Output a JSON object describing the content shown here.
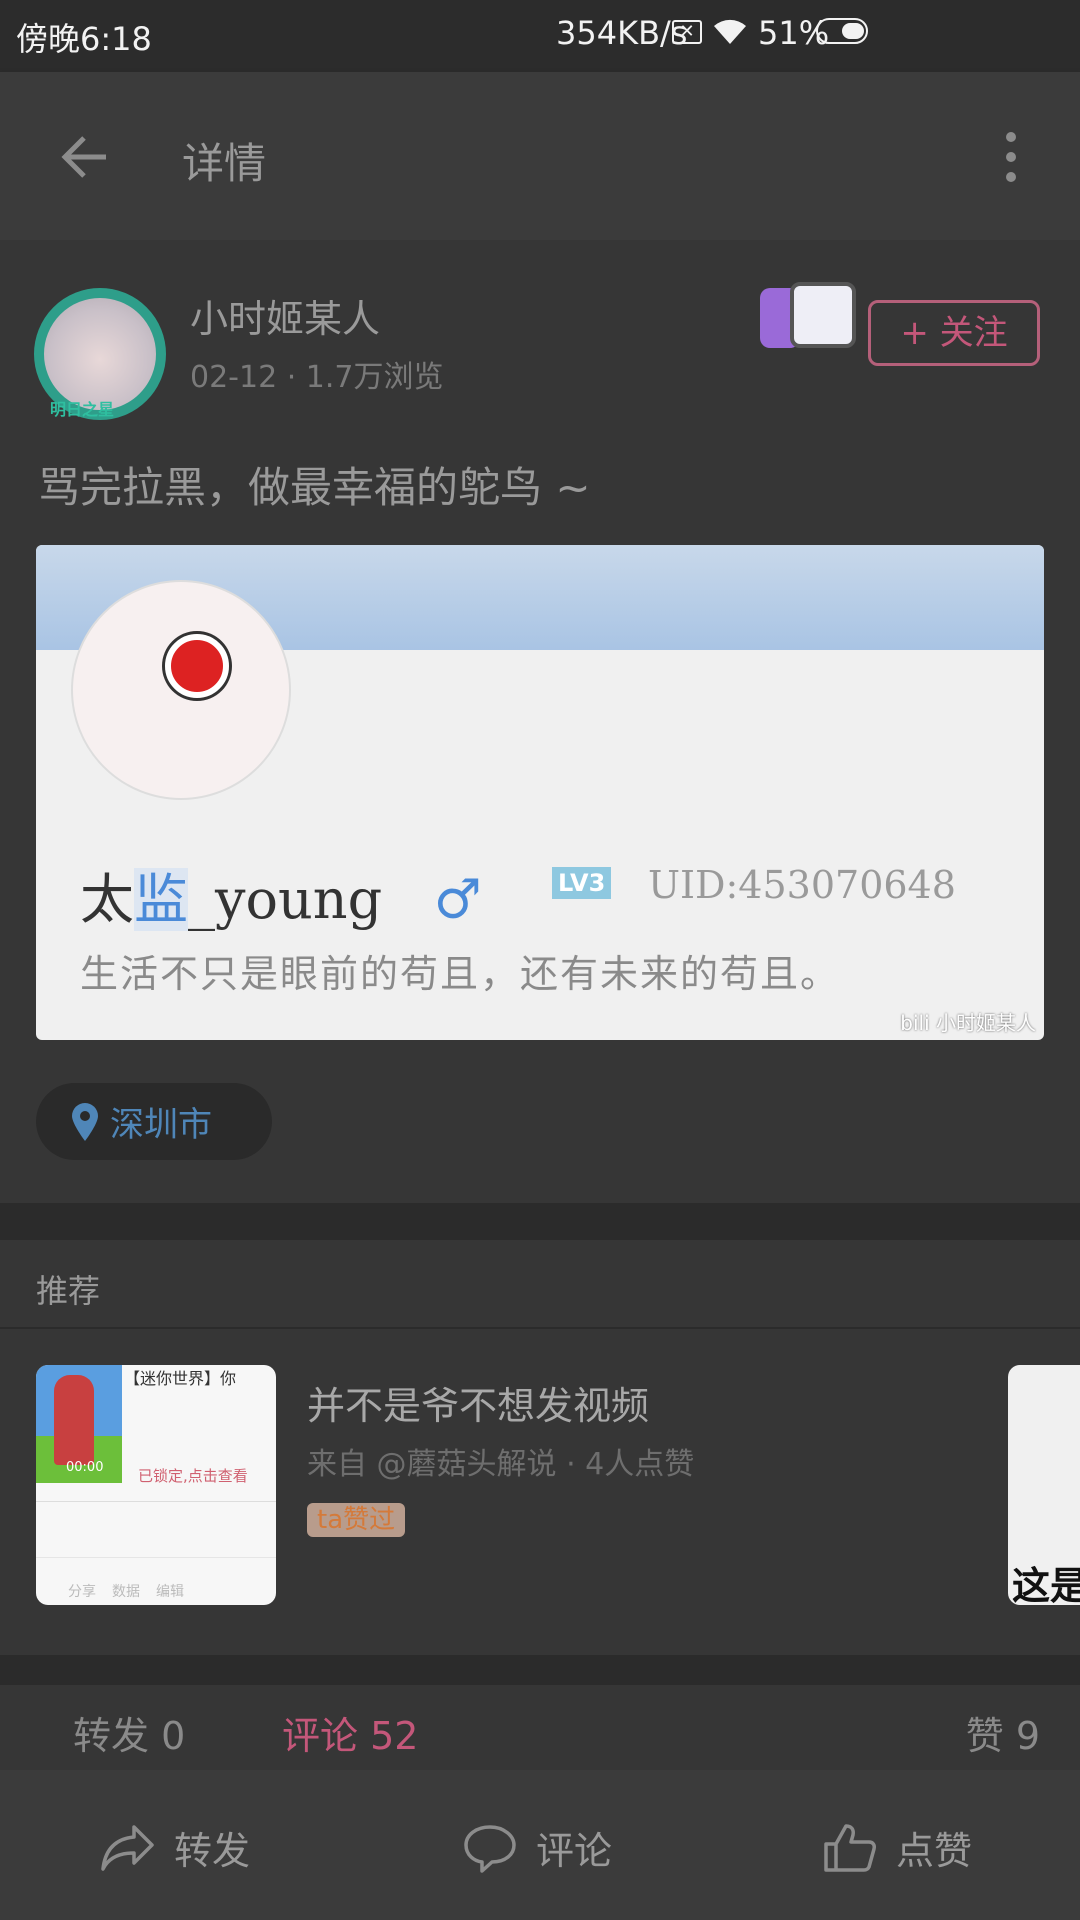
{
  "status_bar": {
    "time": "傍晚6:18",
    "speed": "354KB/s",
    "battery": "51%"
  },
  "app_bar": {
    "title": "详情"
  },
  "post": {
    "author": "小时姬某人",
    "avatar_badge": "明日之星",
    "meta": "02-12 · 1.7万浏览",
    "follow_label": "+ 关注",
    "text": "骂完拉黑，做最幸福的鸵鸟 ~",
    "image": {
      "name_prefix": "太",
      "name_highlight": "监",
      "name_suffix": "_young",
      "gender": "♂",
      "level": "LV3",
      "uid": "UID:453070648",
      "signature": "生活不只是眼前的苟且，还有未来的苟且。",
      "watermark": "bili 小时姬某人"
    },
    "location": "深圳市"
  },
  "recommend": {
    "header": "推荐",
    "items": [
      {
        "title": "并不是爷不想发视频",
        "meta": "来自 @蘑菇头解说 · 4人点赞",
        "tag": "ta赞过",
        "thumb_title": "【迷你世界】你",
        "thumb_time": "00:00",
        "thumb_lock": "已锁定,点击查看",
        "thumb_tabs": [
          "分享",
          "数据",
          "编辑"
        ]
      }
    ],
    "next_thumb_text": "这是"
  },
  "counts": {
    "repost": "转发 0",
    "comment": "评论 52",
    "like": "赞 9"
  },
  "bottom_bar": {
    "repost": "转发",
    "comment": "评论",
    "like": "点赞"
  },
  "colors": {
    "accent": "#c4577a",
    "location": "#4f86b8",
    "tag_bg": "#b89c8c",
    "tag_text": "#d47a3a"
  }
}
